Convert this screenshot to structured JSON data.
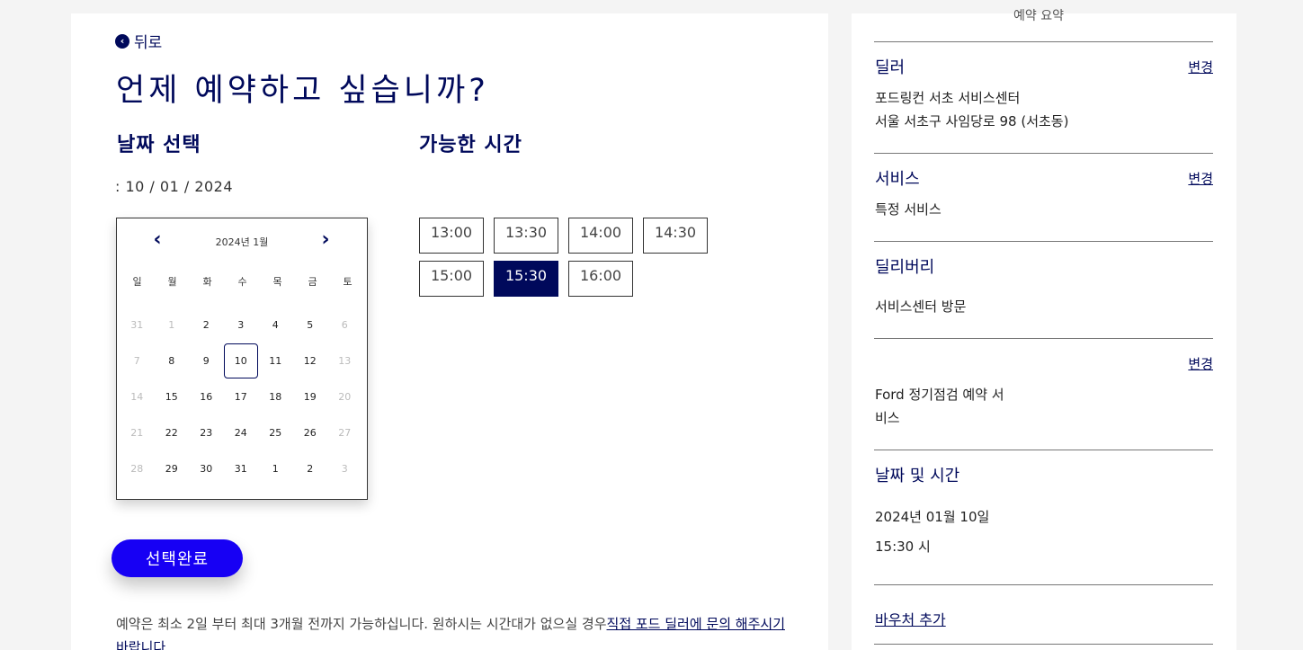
{
  "nav": {
    "back_label": "뒤로"
  },
  "page": {
    "title": "언제 예약하고 싶습니까?"
  },
  "date_section": {
    "title": "날짜 선택",
    "readout": ": 10 / 01 / 2024"
  },
  "time_section": {
    "title": "가능한 시간"
  },
  "calendar": {
    "month_label": "2024년 1월",
    "prev_icon": "chevron-left-icon",
    "next_icon": "chevron-right-icon",
    "weekdays": [
      "일",
      "월",
      "화",
      "수",
      "목",
      "금",
      "토"
    ],
    "days": [
      "31",
      "1",
      "2",
      "3",
      "4",
      "5",
      "6",
      "7",
      "8",
      "9",
      "10",
      "11",
      "12",
      "13",
      "14",
      "15",
      "16",
      "17",
      "18",
      "19",
      "20",
      "21",
      "22",
      "23",
      "24",
      "25",
      "26",
      "27",
      "28",
      "29",
      "30",
      "31",
      "1",
      "2",
      "3"
    ],
    "muted_days_index": [
      0,
      1,
      6,
      7,
      13,
      14,
      20,
      21,
      27,
      28,
      34
    ],
    "selected_index": 10
  },
  "time_slots": [
    "13:00",
    "13:30",
    "14:00",
    "14:30",
    "15:00",
    "15:30",
    "16:00"
  ],
  "selected_time_index": 5,
  "confirm_button": "선택완료",
  "note": {
    "text": "예약은 최소 2일 부터 최대 3개월 전까지 가능하십니다. 원하시는 시간대가 없으실 경우",
    "link": "직접 포드 딜러에 문의 해주시기 바랍니다."
  },
  "summary": {
    "top_clipped": "예약 요약",
    "dealer": {
      "label": "딜러",
      "change": "변경",
      "name": "포드링컨 서초 서비스센터",
      "address": "서울 서초구 사임당로 98 (서초동)"
    },
    "service": {
      "label": "서비스",
      "change": "변경",
      "value": "특정 서비스"
    },
    "delivery": {
      "label": "딜리버리",
      "value": "서비스센터 방문"
    },
    "package": {
      "change": "변경",
      "line1": "Ford 정기점검 예약 서",
      "line2": "비스"
    },
    "datetime": {
      "label": "날짜 및 시간",
      "date": "2024년 01월 10일",
      "time": "15:30 시"
    },
    "voucher": {
      "label": "바우처 추가"
    }
  },
  "colors": {
    "primary": "#00095b",
    "accent": "#1700f4",
    "background": "#f4f4f4"
  }
}
